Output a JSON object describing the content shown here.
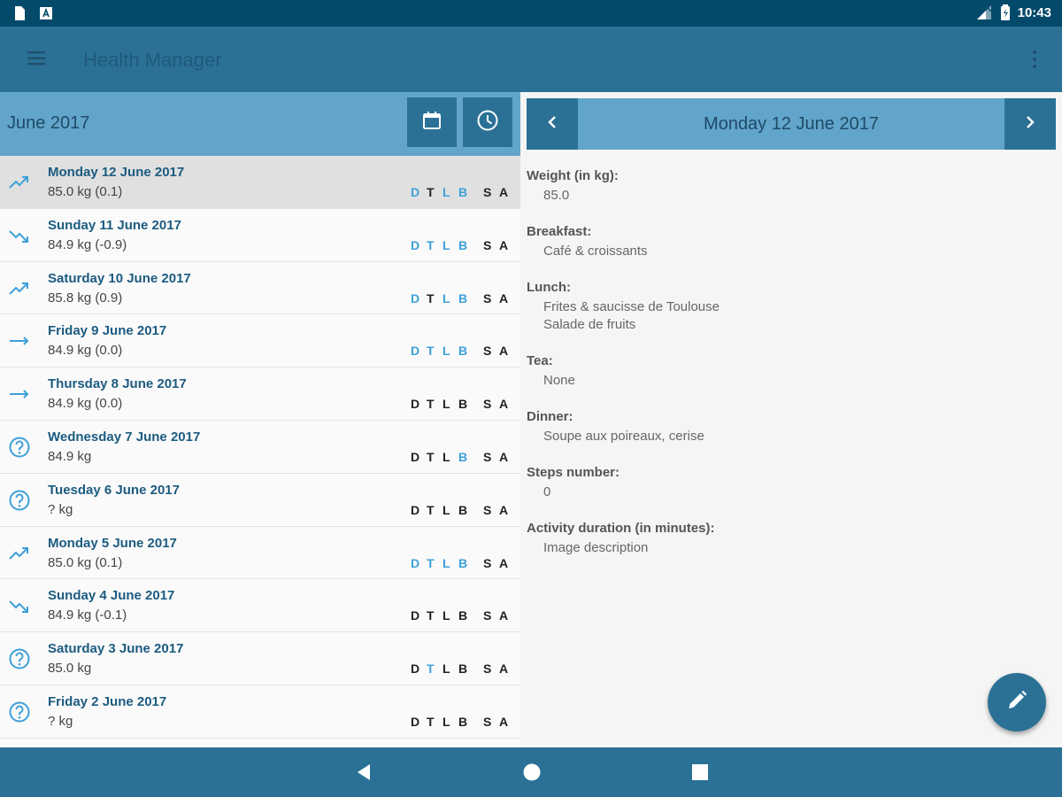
{
  "status_bar": {
    "time": "10:43",
    "left_icons": [
      "document-icon",
      "a-box-icon"
    ],
    "right_icons": [
      "signal-icon",
      "battery-icon"
    ]
  },
  "app_bar": {
    "title": "Health Manager",
    "menu_icon": "hamburger-icon",
    "overflow_icon": "more-vert-icon"
  },
  "month_bar": {
    "title": "June 2017",
    "buttons": [
      "calendar-icon",
      "clock-icon"
    ]
  },
  "days": [
    {
      "title": "Monday 12 June 2017",
      "weight": "85.0 kg (0.1)",
      "trend": "up",
      "selected": true,
      "meals": [
        {
          "l": "D",
          "on": true
        },
        {
          "l": "T",
          "on": false
        },
        {
          "l": "L",
          "on": true
        },
        {
          "l": "B",
          "on": true
        },
        {
          "l": "S",
          "on": false
        },
        {
          "l": "A",
          "on": false
        }
      ]
    },
    {
      "title": "Sunday 11 June 2017",
      "weight": "84.9 kg (-0.9)",
      "trend": "down",
      "selected": false,
      "meals": [
        {
          "l": "D",
          "on": true
        },
        {
          "l": "T",
          "on": true
        },
        {
          "l": "L",
          "on": true
        },
        {
          "l": "B",
          "on": true
        },
        {
          "l": "S",
          "on": false
        },
        {
          "l": "A",
          "on": false
        }
      ]
    },
    {
      "title": "Saturday 10 June 2017",
      "weight": "85.8 kg (0.9)",
      "trend": "up",
      "selected": false,
      "meals": [
        {
          "l": "D",
          "on": true
        },
        {
          "l": "T",
          "on": false
        },
        {
          "l": "L",
          "on": true
        },
        {
          "l": "B",
          "on": true
        },
        {
          "l": "S",
          "on": false
        },
        {
          "l": "A",
          "on": false
        }
      ]
    },
    {
      "title": "Friday 9 June 2017",
      "weight": "84.9 kg (0.0)",
      "trend": "flat",
      "selected": false,
      "meals": [
        {
          "l": "D",
          "on": true
        },
        {
          "l": "T",
          "on": true
        },
        {
          "l": "L",
          "on": true
        },
        {
          "l": "B",
          "on": true
        },
        {
          "l": "S",
          "on": false
        },
        {
          "l": "A",
          "on": false
        }
      ]
    },
    {
      "title": "Thursday 8 June 2017",
      "weight": "84.9 kg (0.0)",
      "trend": "flat",
      "selected": false,
      "meals": [
        {
          "l": "D",
          "on": false
        },
        {
          "l": "T",
          "on": false
        },
        {
          "l": "L",
          "on": false
        },
        {
          "l": "B",
          "on": false
        },
        {
          "l": "S",
          "on": false
        },
        {
          "l": "A",
          "on": false
        }
      ]
    },
    {
      "title": "Wednesday 7 June 2017",
      "weight": "84.9 kg",
      "trend": "unknown",
      "selected": false,
      "meals": [
        {
          "l": "D",
          "on": false
        },
        {
          "l": "T",
          "on": false
        },
        {
          "l": "L",
          "on": false
        },
        {
          "l": "B",
          "on": true
        },
        {
          "l": "S",
          "on": false
        },
        {
          "l": "A",
          "on": false
        }
      ]
    },
    {
      "title": "Tuesday 6 June 2017",
      "weight": "? kg",
      "trend": "unknown",
      "selected": false,
      "meals": [
        {
          "l": "D",
          "on": false
        },
        {
          "l": "T",
          "on": false
        },
        {
          "l": "L",
          "on": false
        },
        {
          "l": "B",
          "on": false
        },
        {
          "l": "S",
          "on": false
        },
        {
          "l": "A",
          "on": false
        }
      ]
    },
    {
      "title": "Monday 5 June 2017",
      "weight": "85.0 kg (0.1)",
      "trend": "up",
      "selected": false,
      "meals": [
        {
          "l": "D",
          "on": true
        },
        {
          "l": "T",
          "on": true
        },
        {
          "l": "L",
          "on": true
        },
        {
          "l": "B",
          "on": true
        },
        {
          "l": "S",
          "on": false
        },
        {
          "l": "A",
          "on": false
        }
      ]
    },
    {
      "title": "Sunday 4 June 2017",
      "weight": "84.9 kg (-0.1)",
      "trend": "down",
      "selected": false,
      "meals": [
        {
          "l": "D",
          "on": false
        },
        {
          "l": "T",
          "on": false
        },
        {
          "l": "L",
          "on": false
        },
        {
          "l": "B",
          "on": false
        },
        {
          "l": "S",
          "on": false
        },
        {
          "l": "A",
          "on": false
        }
      ]
    },
    {
      "title": "Saturday 3 June 2017",
      "weight": "85.0 kg",
      "trend": "unknown",
      "selected": false,
      "meals": [
        {
          "l": "D",
          "on": false
        },
        {
          "l": "T",
          "on": true
        },
        {
          "l": "L",
          "on": false
        },
        {
          "l": "B",
          "on": false
        },
        {
          "l": "S",
          "on": false
        },
        {
          "l": "A",
          "on": false
        }
      ]
    },
    {
      "title": "Friday 2 June 2017",
      "weight": "? kg",
      "trend": "unknown",
      "selected": false,
      "meals": [
        {
          "l": "D",
          "on": false
        },
        {
          "l": "T",
          "on": false
        },
        {
          "l": "L",
          "on": false
        },
        {
          "l": "B",
          "on": false
        },
        {
          "l": "S",
          "on": false
        },
        {
          "l": "A",
          "on": false
        }
      ]
    }
  ],
  "detail": {
    "title": "Monday 12 June 2017",
    "fields": [
      {
        "label": "Weight (in kg):",
        "value": [
          "85.0"
        ]
      },
      {
        "label": "Breakfast:",
        "value": [
          "Café & croissants"
        ]
      },
      {
        "label": "Lunch:",
        "value": [
          "Frites & saucisse de Toulouse",
          "Salade de fruits"
        ]
      },
      {
        "label": "Tea:",
        "value": [
          "None"
        ]
      },
      {
        "label": "Dinner:",
        "value": [
          "Soupe aux poireaux, cerise"
        ]
      },
      {
        "label": "Steps number:",
        "value": [
          "0"
        ]
      },
      {
        "label": "Activity duration (in minutes):",
        "value": [
          "Image description"
        ]
      }
    ]
  },
  "fab_icon": "edit-pencil-icon",
  "nav_bar": [
    "back-icon",
    "home-icon",
    "recents-icon"
  ],
  "colors": {
    "status_bar": "#03496a",
    "primary": "#2b7196",
    "primary_light": "#62a5cb",
    "meal_on": "#3da0d8"
  }
}
